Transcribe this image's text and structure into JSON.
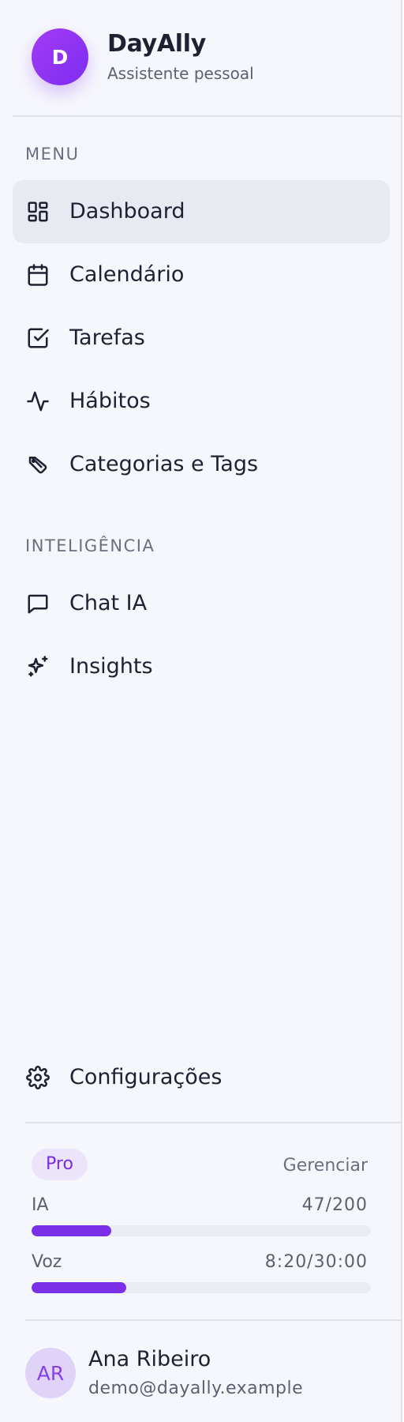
{
  "brand": {
    "initial": "D",
    "name": "DayAlly",
    "subtitle": "Assistente pessoal",
    "gradient": [
      "#a33bf5",
      "#7c2df0"
    ]
  },
  "sections": {
    "menu_label": "MENU",
    "intel_label": "INTELIGÊNCIA"
  },
  "menu": [
    {
      "label": "Dashboard",
      "icon": "dashboard-icon",
      "active": true
    },
    {
      "label": "Calendário",
      "icon": "calendar-icon",
      "active": false
    },
    {
      "label": "Tarefas",
      "icon": "checkbox-icon",
      "active": false
    },
    {
      "label": "Hábitos",
      "icon": "activity-icon",
      "active": false
    },
    {
      "label": "Categorias e Tags",
      "icon": "tag-icon",
      "active": false
    }
  ],
  "intelligence": [
    {
      "label": "Chat IA",
      "icon": "chat-icon"
    },
    {
      "label": "Insights",
      "icon": "sparkles-icon"
    }
  ],
  "settings": {
    "label": "Configurações",
    "icon": "gear-icon"
  },
  "plan": {
    "badge": "Pro",
    "manage_label": "Gerenciar",
    "accent": "#7b2fe6",
    "usage": [
      {
        "label": "IA",
        "value": "47/200",
        "fraction": 0.235
      },
      {
        "label": "Voz",
        "value": "8:20/30:00",
        "fraction": 0.278
      }
    ]
  },
  "user": {
    "initials": "AR",
    "name": "Ana Ribeiro",
    "email": "demo@dayally.example"
  }
}
